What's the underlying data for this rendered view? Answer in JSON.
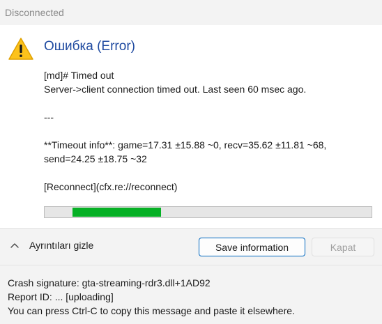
{
  "window": {
    "title": "Disconnected"
  },
  "main": {
    "icon": "warning-icon",
    "heading": "Ошибка (Error)",
    "lines": {
      "error_code": "[md]# Timed out",
      "error_message": "Server->client connection timed out. Last seen 60 msec ago.",
      "separator": "---",
      "timeout_info_1": "**Timeout info**: game=17.31 ±15.88 ~0, recv=35.62 ±11.81 ~68,",
      "timeout_info_2": "send=24.25 ±18.75 ~32",
      "reconnect_link": "[Reconnect](cfx.re://reconnect)"
    },
    "progress": {
      "state": "indeterminate (marquee)",
      "accent": "#06b025"
    }
  },
  "footer": {
    "details_toggle_label": "Ayrıntıları gizle",
    "details_toggle_icon": "chevron-up-icon",
    "save_label": "Save information",
    "close_label": "Kapat",
    "close_enabled": false
  },
  "details": {
    "crash_signature": "Crash signature: gta-streaming-rdr3.dll+1AD92",
    "report_id": "Report ID: ... [uploading]",
    "hint": "You can press Ctrl-C to copy this message and paste it elsewhere."
  }
}
